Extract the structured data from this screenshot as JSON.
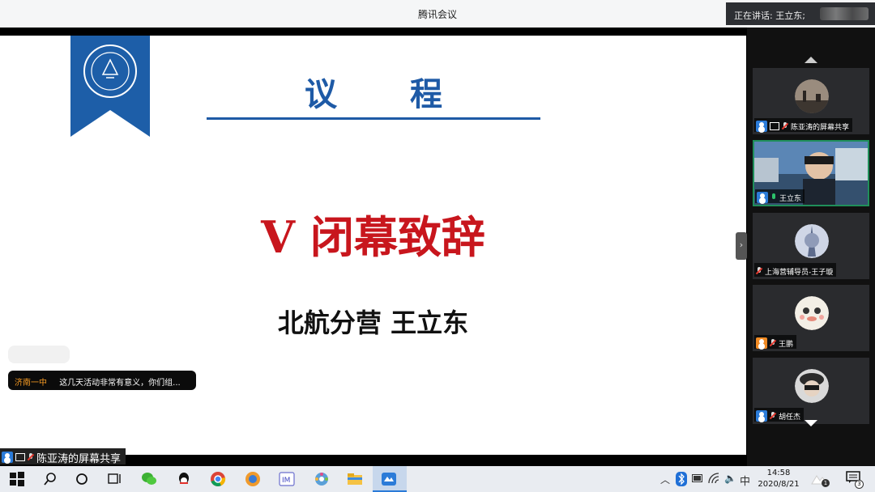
{
  "window": {
    "title": "腾讯会议"
  },
  "speaking": {
    "label": "正在讲话: 王立东;"
  },
  "slide": {
    "title": "议 程",
    "heading": "V 闭幕致辞",
    "subtitle": "北航分营 王立东"
  },
  "chat": {
    "sender": "济南一中",
    "message": "这几天活动非常有意义，你们组..."
  },
  "participants": [
    {
      "name": "陈亚涛的屏幕共享",
      "sharing": true,
      "mic": "muted",
      "role": "host"
    },
    {
      "name": "王立东",
      "sharing": false,
      "mic": "on",
      "role": "host"
    },
    {
      "name": "上海营辅导员-王子璇",
      "sharing": false,
      "mic": "muted",
      "role": "none"
    },
    {
      "name": "王鹏",
      "sharing": false,
      "mic": "muted",
      "role": "guest"
    },
    {
      "name": "胡任杰",
      "sharing": false,
      "mic": "muted",
      "role": "host"
    }
  ],
  "share_bar": {
    "label": "陈亚涛的屏幕共享"
  },
  "taskbar": {
    "ime": "中",
    "time": "14:58",
    "date": "2020/8/21",
    "notification_count": "3",
    "badge_count": "1"
  },
  "colors": {
    "slide_blue": "#1e5aa6",
    "slide_red": "#c8161d",
    "accent": "#2b7bd8"
  },
  "icons": [
    "windows-start-icon",
    "search-icon",
    "cortana-icon",
    "task-view-icon",
    "wechat-icon",
    "qq-icon",
    "chrome-icon",
    "browser-icon",
    "app-icon",
    "media-icon",
    "folder-icon",
    "tencent-meeting-icon"
  ]
}
